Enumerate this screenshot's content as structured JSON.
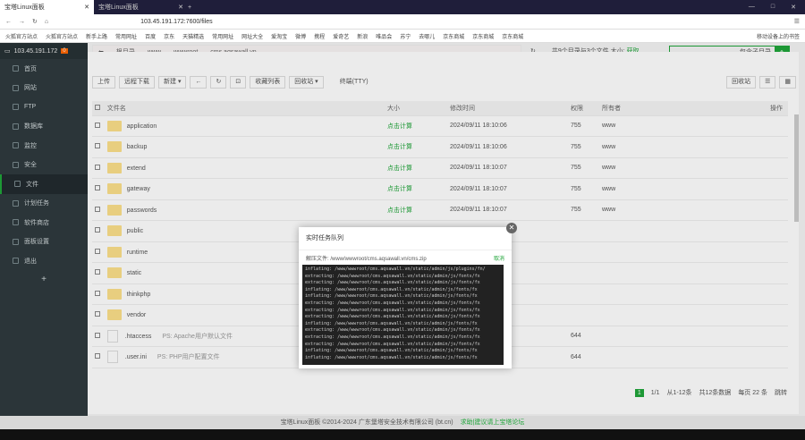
{
  "browser": {
    "tabs": [
      {
        "title": "宝塔Linux面板"
      },
      {
        "title": "宝塔Linux面板"
      }
    ],
    "url": "103.45.191.172:7600/files",
    "bookmarks": [
      "火狐官方站点",
      "火狐官方站点",
      "新手上路",
      "常用网址",
      "百度",
      "京东",
      "天猫精选",
      "常用网址",
      "网址大全",
      "爱淘宝",
      "微博",
      "携程",
      "爱奇艺",
      "新浪",
      "唯品会",
      "苏宁",
      "去哪儿",
      "京东商城",
      "京东商城",
      "京东商城"
    ],
    "bookmark_folder": "移动设备上的书签"
  },
  "sidebar": {
    "host": "103.45.191.172",
    "badge": "0",
    "items": [
      "首页",
      "网站",
      "FTP",
      "数据库",
      "监控",
      "安全",
      "文件",
      "计划任务",
      "软件商店",
      "面板设置",
      "退出"
    ],
    "active": "文件",
    "add": "+"
  },
  "breadcrumb": {
    "items": [
      "根目录",
      "www",
      "wwwroot",
      "cms.aqsawall.vn"
    ]
  },
  "info": {
    "text": "共9个目录与3个文件,大小:",
    "link": "获取"
  },
  "search": {
    "label": "包含子目录"
  },
  "toolbar": {
    "buttons": [
      "上传",
      "远程下载",
      "新建 ▾",
      "←",
      "↻",
      "⊡",
      "收藏列表",
      "回收站 ▾"
    ],
    "terminal": "终端(TTY)",
    "right": [
      "回收站"
    ]
  },
  "table": {
    "headers": [
      "文件名",
      "大小",
      "修改时间",
      "权限",
      "所有者",
      "操作"
    ],
    "rows": [
      {
        "name": "application",
        "size": "点击计算",
        "time": "2024/09/11 18:10:06",
        "perm": "755",
        "owner": "www",
        "dir": true
      },
      {
        "name": "backup",
        "size": "点击计算",
        "time": "2024/09/11 18:10:06",
        "perm": "755",
        "owner": "www",
        "dir": true
      },
      {
        "name": "extend",
        "size": "点击计算",
        "time": "2024/09/11 18:10:07",
        "perm": "755",
        "owner": "www",
        "dir": true
      },
      {
        "name": "gateway",
        "size": "点击计算",
        "time": "2024/09/11 18:10:07",
        "perm": "755",
        "owner": "www",
        "dir": true
      },
      {
        "name": "passwords",
        "size": "点击计算",
        "time": "2024/09/11 18:10:07",
        "perm": "755",
        "owner": "www",
        "dir": true
      },
      {
        "name": "public",
        "size": "",
        "time": "",
        "perm": "",
        "owner": "",
        "dir": true
      },
      {
        "name": "runtime",
        "size": "",
        "time": "",
        "perm": "",
        "owner": "",
        "dir": true
      },
      {
        "name": "static",
        "size": "",
        "time": "",
        "perm": "",
        "owner": "",
        "dir": true
      },
      {
        "name": "thinkphp",
        "size": "",
        "time": "",
        "perm": "",
        "owner": "",
        "dir": true
      },
      {
        "name": "vendor",
        "size": "",
        "time": "",
        "perm": "",
        "owner": "",
        "dir": true
      },
      {
        "name": ".htaccess",
        "note": "PS: Apache用户默认文件",
        "size": "",
        "time": "",
        "perm": "644",
        "owner": "",
        "dir": false
      },
      {
        "name": ".user.ini",
        "note": "PS: PHP用户配置文件",
        "size": "",
        "time": "",
        "perm": "644",
        "owner": "",
        "dir": false
      }
    ]
  },
  "pager": {
    "current": "1",
    "items": [
      "1/1",
      "从1-12条",
      "共12条数据",
      "每页 22 条",
      "跳转"
    ]
  },
  "modal": {
    "title": "实时任务队列",
    "path": "解压文件: /www/wwwroot/cms.aqsawall.vn/cms.zip",
    "link": "取消",
    "lines": [
      "inflating: /www/wwwroot/cms.aqsawall.vn/static/admin/js/plugins/fn/",
      "extracting: /www/wwwroot/cms.aqsawall.vn/static/admin/js/fonts/fx",
      "extracting: /www/wwwroot/cms.aqsawall.vn/static/admin/js/fonts/fx",
      "inflating: /www/wwwroot/cms.aqsawall.vn/static/admin/js/fonts/fx",
      "inflating: /www/wwwroot/cms.aqsawall.vn/static/admin/js/fonts/fx",
      "extracting: /www/wwwroot/cms.aqsawall.vn/static/admin/js/fonts/fx",
      "extracting: /www/wwwroot/cms.aqsawall.vn/static/admin/js/fonts/fx",
      "extracting: /www/wwwroot/cms.aqsawall.vn/static/admin/js/fonts/fx",
      "inflating: /www/wwwroot/cms.aqsawall.vn/static/admin/js/fonts/fx",
      "extracting: /www/wwwroot/cms.aqsawall.vn/static/admin/js/fonts/fx",
      "extracting: /www/wwwroot/cms.aqsawall.vn/static/admin/js/fonts/fx",
      "extracting: /www/wwwroot/cms.aqsawall.vn/static/admin/js/fonts/fx",
      "inflating: /www/wwwroot/cms.aqsawall.vn/static/admin/js/fonts/fx",
      "inflating: /www/wwwroot/cms.aqsawall.vn/static/admin/js/fonts/fx"
    ]
  },
  "footer": {
    "text": "宝塔Linux面板 ©2014-2024 广东堡塔安全技术有限公司 (bt.cn)",
    "link": "求助|建议请上宝塔论坛"
  }
}
